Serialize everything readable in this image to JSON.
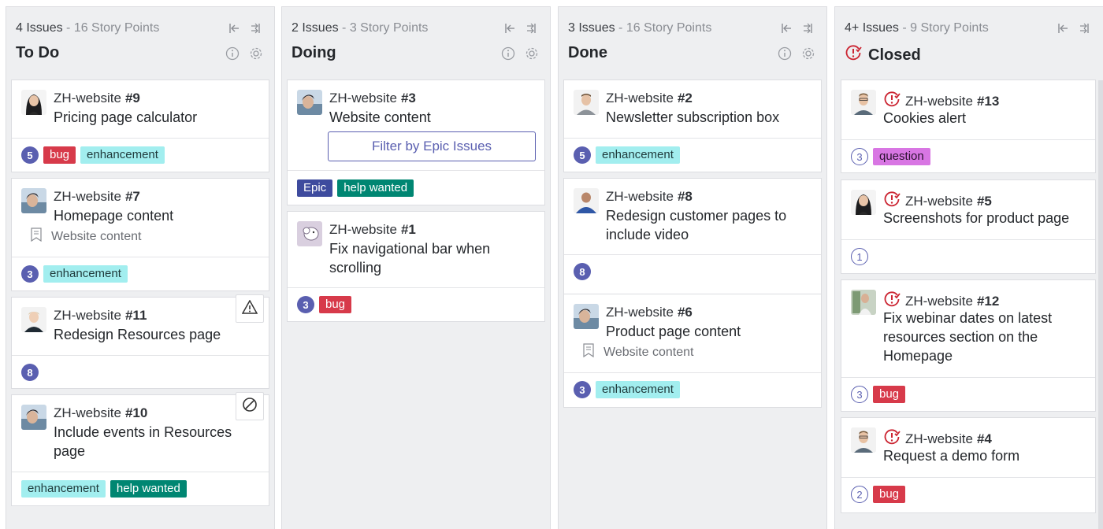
{
  "columns": [
    {
      "meta_issues": "4 Issues",
      "meta_points": " - 16 Story Points",
      "title": "To Do",
      "cards": [
        {
          "repo": "ZH-website",
          "number": "#9",
          "title": "Pricing page calculator",
          "estimate": "5",
          "labels": [
            "bug",
            "enhancement"
          ]
        },
        {
          "repo": "ZH-website",
          "number": "#7",
          "title": "Homepage content",
          "epic": "Website content",
          "estimate": "3",
          "labels": [
            "enhancement"
          ]
        },
        {
          "repo": "ZH-website",
          "number": "#11",
          "title": "Redesign Resources page",
          "estimate": "8",
          "labels": []
        },
        {
          "repo": "ZH-website",
          "number": "#10",
          "title": "Include events in Resources page",
          "labels": [
            "enhancement",
            "help wanted"
          ]
        }
      ]
    },
    {
      "meta_issues": "2 Issues",
      "meta_points": " - 3 Story Points",
      "title": "Doing",
      "cards": [
        {
          "repo": "ZH-website",
          "number": "#3",
          "title": "Website content",
          "filter_button": "Filter by Epic Issues",
          "labels": [
            "Epic",
            "help wanted"
          ]
        },
        {
          "repo": "ZH-website",
          "number": "#1",
          "title": "Fix navigational bar when scrolling",
          "estimate": "3",
          "labels": [
            "bug"
          ]
        }
      ]
    },
    {
      "meta_issues": "3 Issues",
      "meta_points": " - 16 Story Points",
      "title": "Done",
      "cards": [
        {
          "repo": "ZH-website",
          "number": "#2",
          "title": "Newsletter subscription box",
          "estimate": "5",
          "labels": [
            "enhancement"
          ]
        },
        {
          "repo": "ZH-website",
          "number": "#8",
          "title": "Redesign customer pages to include video",
          "estimate": "8",
          "labels": []
        },
        {
          "repo": "ZH-website",
          "number": "#6",
          "title": "Product page content",
          "epic": "Website content",
          "estimate": "3",
          "labels": [
            "enhancement"
          ]
        }
      ]
    },
    {
      "meta_issues": "4+ Issues",
      "meta_points": " - 9 Story Points",
      "title": "Closed",
      "cards": [
        {
          "repo": "ZH-website",
          "number": "#13",
          "title": "Cookies alert",
          "estimate": "3",
          "labels": [
            "question"
          ]
        },
        {
          "repo": "ZH-website",
          "number": "#5",
          "title": "Screenshots for product page",
          "estimate": "1",
          "labels": []
        },
        {
          "repo": "ZH-website",
          "number": "#12",
          "title": "Fix webinar dates on latest resources section on the Homepage",
          "estimate": "3",
          "labels": [
            "bug"
          ]
        },
        {
          "repo": "ZH-website",
          "number": "#4",
          "title": "Request a demo form",
          "estimate": "2",
          "labels": [
            "bug"
          ]
        }
      ]
    }
  ],
  "icons": {
    "collapse": "collapse-left-icon",
    "expand": "expand-columns-icon",
    "info": "info-icon",
    "settings": "gear-icon",
    "epic": "epic-icon",
    "blocked": "warning-icon",
    "blocking": "blocked-icon",
    "closed": "closed-issue-icon"
  },
  "colors": {
    "estimate": "#5a5fb0",
    "bug": "#d73a4a",
    "enhancement": "#a2eeef",
    "help_wanted": "#008672",
    "epic": "#3e4b9e",
    "question": "#d876e3",
    "closed": "#cb2431"
  }
}
